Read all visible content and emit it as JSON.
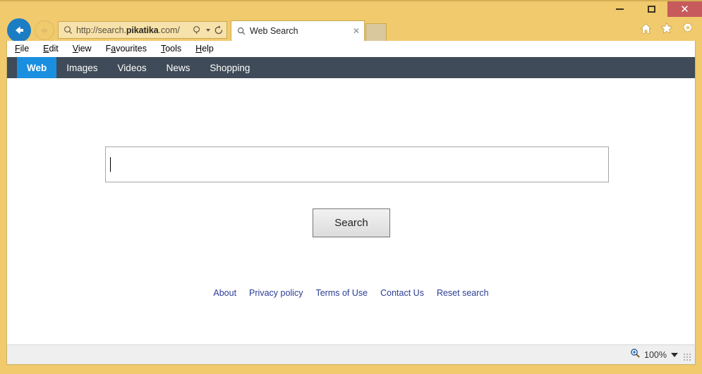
{
  "window": {
    "frame_color": "#f0ca6c",
    "controls": {
      "minimize_icon": "minimize-icon",
      "maximize_icon": "maximize-icon",
      "close_icon": "close-icon",
      "close_label": "✕",
      "close_color": "#c75b5b"
    }
  },
  "toolbar": {
    "back_icon": "back-arrow-icon",
    "forward_icon": "forward-arrow-icon",
    "address": {
      "search_icon": "search-icon",
      "url_prefix": "http://search.",
      "url_domain": "pikatika",
      "url_suffix": ".com/",
      "full_url": "http://search.pikatika.com/",
      "dropdown_icon": "search-dropdown-icon",
      "refresh_icon": "refresh-icon",
      "refresh_glyph": "↻"
    },
    "tab": {
      "favicon": "search-icon",
      "title": "Web Search",
      "close_icon": "tab-close-icon",
      "close_glyph": "✕"
    },
    "new_tab_icon": "new-tab-button",
    "icons": [
      {
        "name": "home-icon",
        "label": "Home"
      },
      {
        "name": "favorites-star-icon",
        "label": "Favourites"
      },
      {
        "name": "settings-gear-icon",
        "label": "Tools"
      }
    ]
  },
  "menubar": {
    "items": [
      {
        "accel": "F",
        "rest": "ile"
      },
      {
        "accel": "E",
        "rest": "dit"
      },
      {
        "accel": "V",
        "rest": "iew"
      },
      {
        "pre": "F",
        "accel": "a",
        "rest": "vourites"
      },
      {
        "accel": "T",
        "rest": "ools"
      },
      {
        "accel": "H",
        "rest": "elp"
      }
    ]
  },
  "sitenav": {
    "background": "#3f4b58",
    "active_color": "#1a8fe0",
    "items": [
      {
        "label": "Web",
        "active": true
      },
      {
        "label": "Images",
        "active": false
      },
      {
        "label": "Videos",
        "active": false
      },
      {
        "label": "News",
        "active": false
      },
      {
        "label": "Shopping",
        "active": false
      }
    ]
  },
  "page": {
    "search_input": {
      "value": "",
      "placeholder": ""
    },
    "search_button_label": "Search",
    "footer_links": [
      "About",
      "Privacy policy",
      "Terms of Use",
      "Contact Us",
      "Reset search"
    ],
    "footer_link_color": "#2b3c94"
  },
  "statusbar": {
    "zoom_icon": "zoom-magnifier-icon",
    "zoom_level": "100%",
    "dropdown_icon": "zoom-dropdown-icon",
    "resize_grip_icon": "resize-grip-icon"
  }
}
